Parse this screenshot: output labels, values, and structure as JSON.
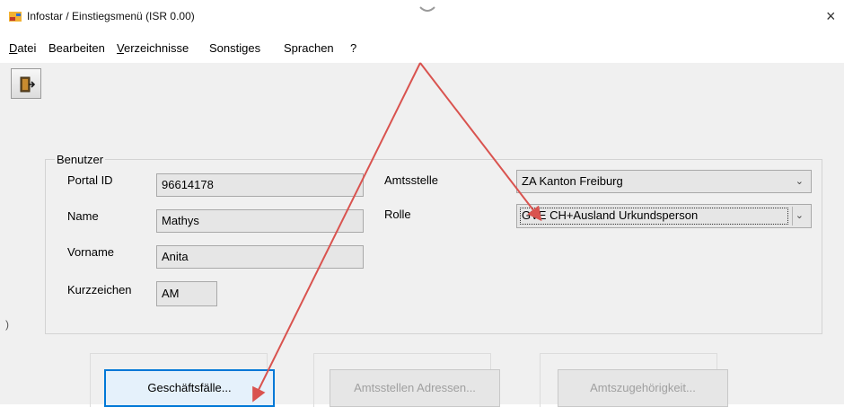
{
  "window": {
    "title": "Infostar / Einstiegsmenü (ISR 0.00)",
    "close_label": "×"
  },
  "menu": [
    {
      "label": "Datei",
      "mnemonic": "D",
      "rest": "atei",
      "enabled": true
    },
    {
      "label": "Bearbeiten",
      "enabled": true
    },
    {
      "label": "Verzeichnisse",
      "mnemonic": "V",
      "rest": "erzeichnisse",
      "enabled": false
    },
    {
      "label": "Sonstiges",
      "enabled": true
    },
    {
      "label": "Sprachen",
      "enabled": true
    },
    {
      "label": "?",
      "enabled": true
    }
  ],
  "toolbar": {
    "exit_icon": "exit-door-icon"
  },
  "user_group": {
    "legend": "Benutzer",
    "portal_id_label": "Portal ID",
    "portal_id_value": "96614178",
    "name_label": "Name",
    "name_value": "Mathys",
    "vorname_label": "Vorname",
    "vorname_value": "Anita",
    "kurzzeichen_label": "Kurzzeichen",
    "kurzzeichen_value": "AM",
    "amtsstelle_label": "Amtsstelle",
    "amtsstelle_value": "ZA Kanton Freiburg",
    "rolle_label": "Rolle",
    "rolle_value": "GVE CH+Ausland Urkundsperson"
  },
  "buttons": {
    "geschaeftsfaelle": "Geschäftsfälle...",
    "amtsstellen_adressen": "Amtsstellen Adressen...",
    "amtszugehoerigkeit": "Amtszugehörigkeit..."
  },
  "colors": {
    "annotation_arrow": "#d9534f",
    "focus_border": "#0078d7"
  }
}
